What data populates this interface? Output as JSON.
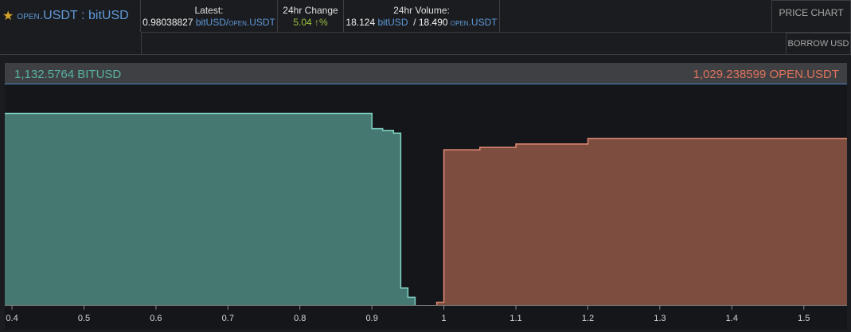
{
  "header": {
    "pair": {
      "base_prefix": "OPEN",
      "base": ".USDT",
      "separator": " : ",
      "quote": "bitUSD"
    },
    "latest": {
      "label": "Latest:",
      "price": "0.98038827",
      "quote_unit": "bitUSD/",
      "base_prefix": "OPEN",
      "base_unit": ".USDT"
    },
    "change": {
      "label": "24hr Change",
      "value": "5.04",
      "arrow": "↑",
      "unit": "%"
    },
    "volume": {
      "label": "24hr Volume:",
      "quote_value": "18.124",
      "quote_unit": "bitUSD",
      "separator": " / ",
      "base_value": "18.490",
      "base_prefix": "OPEN",
      "base_unit": ".USDT"
    },
    "price_chart_label": "PRICE CHART",
    "borrow_label": "BORROW USD"
  },
  "colors": {
    "accent": "#5f9ad8",
    "bid_fill": "#447870",
    "bid_line": "#7fd3c4",
    "ask_fill": "#7d4d40",
    "ask_line": "#e38a75",
    "change_positive": "#9ac23c"
  },
  "depth": {
    "bid_total": "1,132.5764 BITUSD",
    "ask_total": "1,029.238599 OPEN.USDT"
  },
  "chart_data": {
    "type": "area",
    "xlim": [
      0.39,
      1.56
    ],
    "ylim": [
      0,
      1300
    ],
    "x_ticks": [
      0.4,
      0.5,
      0.6,
      0.7,
      0.8,
      0.9,
      1,
      1.1,
      1.2,
      1.3,
      1.4,
      1.5
    ],
    "x_tick_labels": [
      "0.4",
      "0.5",
      "0.6",
      "0.7",
      "0.8",
      "0.9",
      "1",
      "1.1",
      "1.2",
      "1.3",
      "1.4",
      "1.5"
    ],
    "series": [
      {
        "side": "bid",
        "points": [
          [
            0.39,
            1132.58
          ],
          [
            0.9,
            1132.58
          ],
          [
            0.9,
            1043
          ],
          [
            0.915,
            1043
          ],
          [
            0.915,
            1033
          ],
          [
            0.93,
            1033
          ],
          [
            0.93,
            1016
          ],
          [
            0.94,
            1016
          ],
          [
            0.94,
            100
          ],
          [
            0.95,
            100
          ],
          [
            0.95,
            45
          ],
          [
            0.96,
            45
          ],
          [
            0.96,
            0
          ]
        ]
      },
      {
        "side": "ask",
        "points": [
          [
            0.99,
            0
          ],
          [
            0.99,
            16
          ],
          [
            1.0,
            16
          ],
          [
            1.0,
            918
          ],
          [
            1.05,
            918
          ],
          [
            1.05,
            932
          ],
          [
            1.1,
            932
          ],
          [
            1.1,
            952
          ],
          [
            1.2,
            952
          ],
          [
            1.2,
            985
          ],
          [
            1.56,
            985
          ]
        ]
      }
    ]
  }
}
